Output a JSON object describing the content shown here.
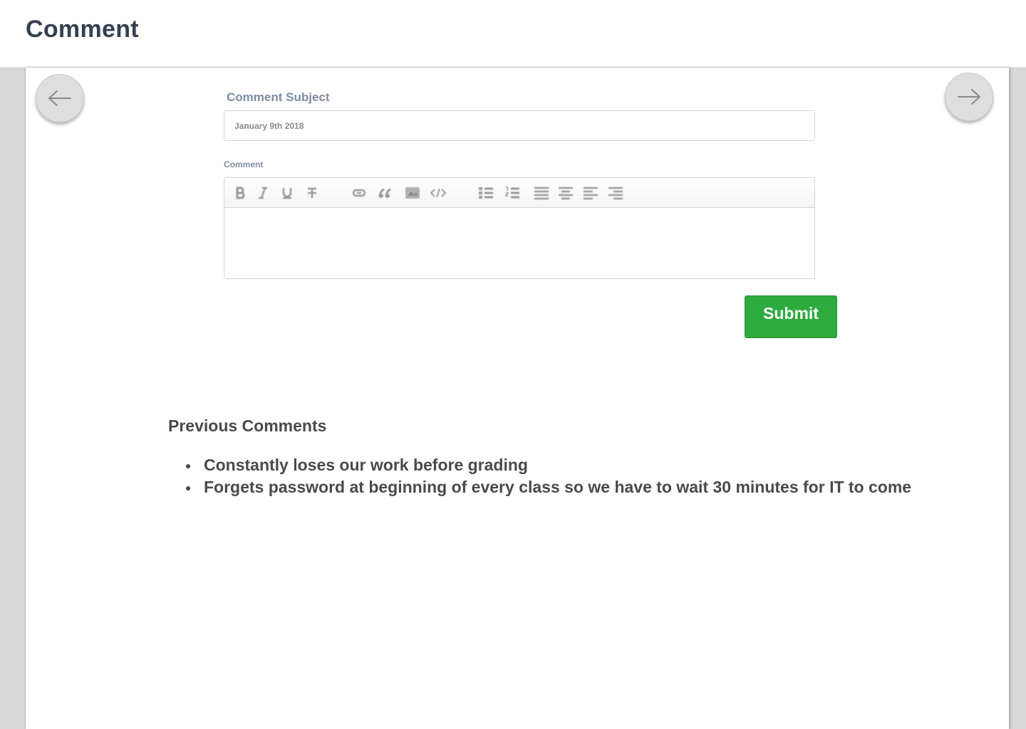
{
  "header": {
    "title": "Comment"
  },
  "navigation": {
    "prev_icon": "arrow-left-icon",
    "next_icon": "arrow-right-icon"
  },
  "form": {
    "subject_label": "Comment Subject",
    "subject_value": "January 9th 2018",
    "comment_label": "Comment",
    "comment_value": "",
    "toolbar": [
      {
        "name": "bold-icon"
      },
      {
        "name": "italic-icon"
      },
      {
        "name": "underline-icon"
      },
      {
        "name": "strikethrough-icon"
      },
      {
        "name": "link-icon"
      },
      {
        "name": "quote-icon"
      },
      {
        "name": "image-icon"
      },
      {
        "name": "code-icon"
      },
      {
        "name": "bulleted-list-icon"
      },
      {
        "name": "numbered-list-icon"
      },
      {
        "name": "align-justify-icon"
      },
      {
        "name": "align-center-icon"
      },
      {
        "name": "align-left-icon"
      },
      {
        "name": "align-right-icon"
      }
    ],
    "submit_label": "Submit"
  },
  "previous_comments": {
    "heading": "Previous Comments",
    "items": [
      "Constantly loses our work before grading",
      "Forgets password at beginning of every class so we have to wait 30 minutes for IT to come"
    ]
  },
  "colors": {
    "submit": "#2eab3f",
    "title": "#34404f",
    "label": "#7d8ba0",
    "text": "#4a4a4a"
  }
}
